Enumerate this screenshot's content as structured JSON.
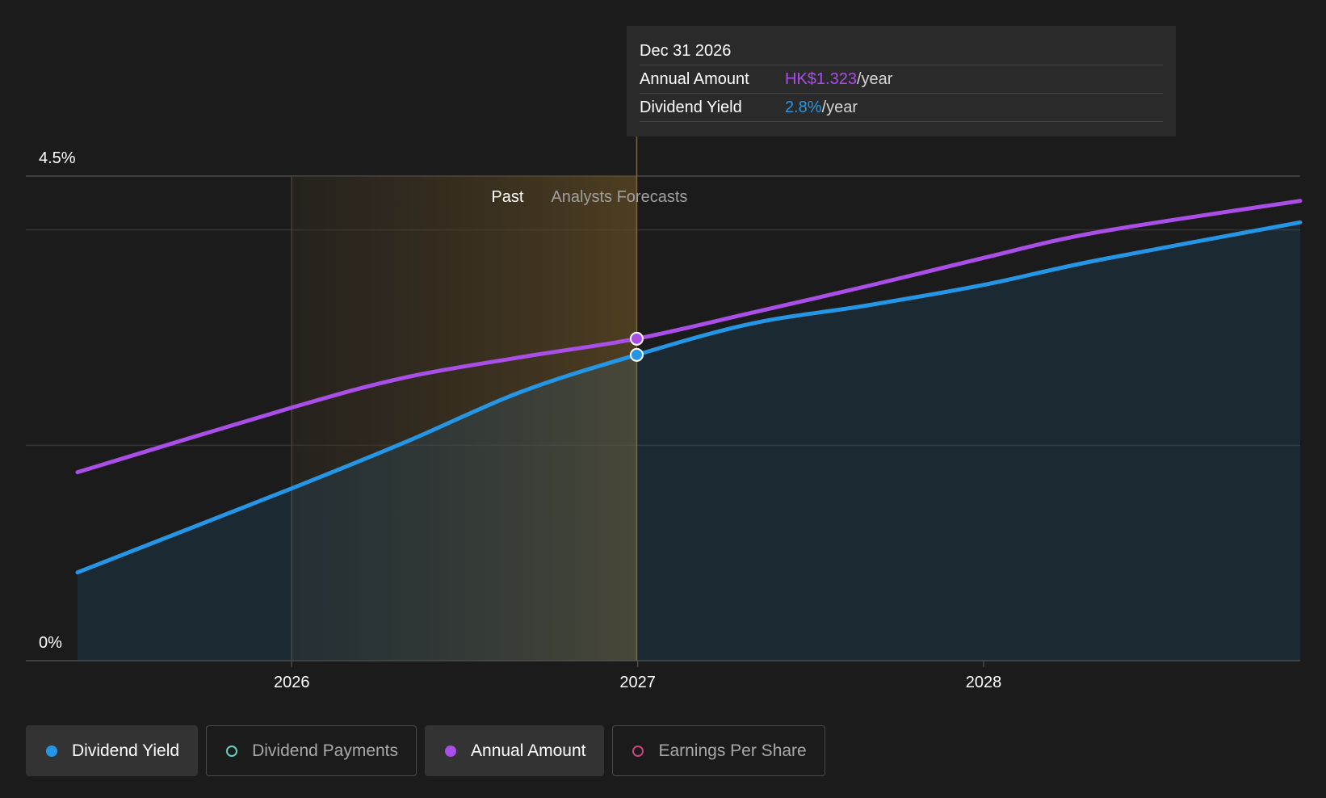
{
  "chart_data": {
    "type": "line",
    "x_ticks": [
      "2026",
      "2027",
      "2028"
    ],
    "y_ticks": [
      "4.5%",
      "0%"
    ],
    "ylim": [
      0,
      4.5
    ],
    "x_range": [
      "2025-05-20",
      "2028-11-30"
    ],
    "regions": {
      "past_label": "Past",
      "forecast_label": "Analysts Forecasts",
      "past_end": "2026-12-31"
    },
    "series": [
      {
        "name": "Dividend Yield",
        "color": "#2596e6",
        "fill": true,
        "points": [
          {
            "x": "2025-05-20",
            "y": 0.82
          },
          {
            "x": "2026-01-01",
            "y": 1.6
          },
          {
            "x": "2026-05-01",
            "y": 2.03
          },
          {
            "x": "2026-09-01",
            "y": 2.5
          },
          {
            "x": "2026-12-31",
            "y": 2.84
          },
          {
            "x": "2027-05-01",
            "y": 3.13
          },
          {
            "x": "2027-09-01",
            "y": 3.3
          },
          {
            "x": "2028-01-01",
            "y": 3.49
          },
          {
            "x": "2028-05-01",
            "y": 3.72
          },
          {
            "x": "2028-11-30",
            "y": 4.07
          }
        ]
      },
      {
        "name": "Annual Amount",
        "color": "#a94ee6",
        "fill": false,
        "points": [
          {
            "x": "2025-05-20",
            "y": 1.75
          },
          {
            "x": "2026-01-01",
            "y": 2.35
          },
          {
            "x": "2026-05-01",
            "y": 2.63
          },
          {
            "x": "2026-09-01",
            "y": 2.82
          },
          {
            "x": "2026-12-31",
            "y": 2.99
          },
          {
            "x": "2027-05-01",
            "y": 3.23
          },
          {
            "x": "2027-09-01",
            "y": 3.48
          },
          {
            "x": "2028-01-01",
            "y": 3.74
          },
          {
            "x": "2028-05-01",
            "y": 3.98
          },
          {
            "x": "2028-11-30",
            "y": 4.27
          }
        ]
      }
    ],
    "tooltip": {
      "date": "Dec 31 2026",
      "rows": [
        {
          "label": "Annual Amount",
          "value": "HK$1.323",
          "unit": "/year",
          "color": "#a94ee6"
        },
        {
          "label": "Dividend Yield",
          "value": "2.8%",
          "unit": "/year",
          "color": "#2596e6"
        }
      ]
    }
  },
  "legend": [
    {
      "label": "Dividend Yield",
      "color": "#2596e6",
      "active": true
    },
    {
      "label": "Dividend Payments",
      "color": "#5fd3c0",
      "active": false
    },
    {
      "label": "Annual Amount",
      "color": "#a94ee6",
      "active": true
    },
    {
      "label": "Earnings Per Share",
      "color": "#c8447e",
      "active": false
    }
  ]
}
